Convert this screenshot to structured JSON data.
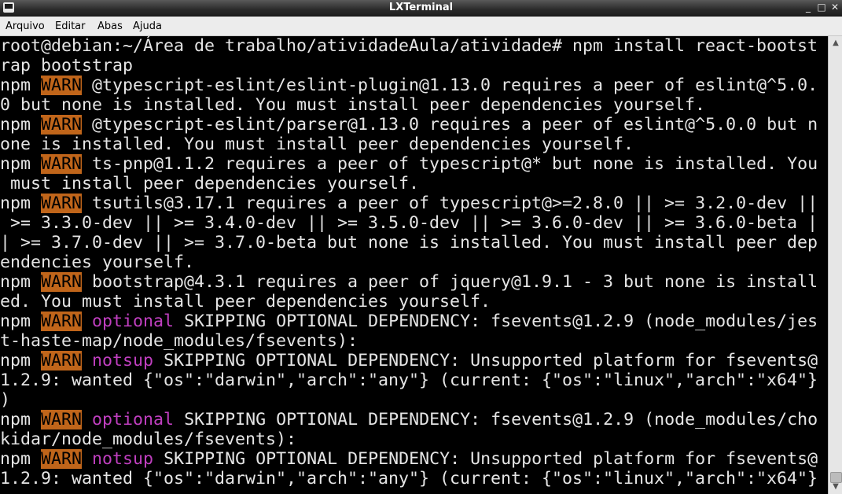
{
  "window": {
    "title": "LXTerminal",
    "buttons": {
      "minimize": "_",
      "maximize": "□",
      "close": "✕"
    }
  },
  "menubar": {
    "items": [
      "Arquivo",
      "Editar",
      "Abas",
      "Ajuda"
    ]
  },
  "terminal": {
    "lines": [
      [
        {
          "t": "root@debian:~/Área de trabalho/atividadeAula/atividade# npm install react-bootst"
        }
      ],
      [
        {
          "t": "rap bootstrap"
        }
      ],
      [
        {
          "t": "npm "
        },
        {
          "t": "WARN",
          "s": "warn"
        },
        {
          "t": " @typescript-eslint/eslint-plugin@1.13.0 requires a peer of eslint@^5.0."
        }
      ],
      [
        {
          "t": "0 but none is installed. You must install peer dependencies yourself."
        }
      ],
      [
        {
          "t": "npm "
        },
        {
          "t": "WARN",
          "s": "warn"
        },
        {
          "t": " @typescript-eslint/parser@1.13.0 requires a peer of eslint@^5.0.0 but n"
        }
      ],
      [
        {
          "t": "one is installed. You must install peer dependencies yourself."
        }
      ],
      [
        {
          "t": "npm "
        },
        {
          "t": "WARN",
          "s": "warn"
        },
        {
          "t": " ts-pnp@1.1.2 requires a peer of typescript@* but none is installed. You"
        }
      ],
      [
        {
          "t": " must install peer dependencies yourself."
        }
      ],
      [
        {
          "t": "npm "
        },
        {
          "t": "WARN",
          "s": "warn"
        },
        {
          "t": " tsutils@3.17.1 requires a peer of typescript@>=2.8.0 || >= 3.2.0-dev ||"
        }
      ],
      [
        {
          "t": " >= 3.3.0-dev || >= 3.4.0-dev || >= 3.5.0-dev || >= 3.6.0-dev || >= 3.6.0-beta |"
        }
      ],
      [
        {
          "t": "| >= 3.7.0-dev || >= 3.7.0-beta but none is installed. You must install peer dep"
        }
      ],
      [
        {
          "t": "endencies yourself."
        }
      ],
      [
        {
          "t": "npm "
        },
        {
          "t": "WARN",
          "s": "warn"
        },
        {
          "t": " bootstrap@4.3.1 requires a peer of jquery@1.9.1 - 3 but none is install"
        }
      ],
      [
        {
          "t": "ed. You must install peer dependencies yourself."
        }
      ],
      [
        {
          "t": "npm "
        },
        {
          "t": "WARN",
          "s": "warn"
        },
        {
          "t": " "
        },
        {
          "t": "optional",
          "s": "mag"
        },
        {
          "t": " SKIPPING OPTIONAL DEPENDENCY: fsevents@1.2.9 (node_modules/jes"
        }
      ],
      [
        {
          "t": "t-haste-map/node_modules/fsevents):"
        }
      ],
      [
        {
          "t": "npm "
        },
        {
          "t": "WARN",
          "s": "warn"
        },
        {
          "t": " "
        },
        {
          "t": "notsup",
          "s": "mag"
        },
        {
          "t": " SKIPPING OPTIONAL DEPENDENCY: Unsupported platform for fsevents@"
        }
      ],
      [
        {
          "t": "1.2.9: wanted {\"os\":\"darwin\",\"arch\":\"any\"} (current: {\"os\":\"linux\",\"arch\":\"x64\"}"
        }
      ],
      [
        {
          "t": ")"
        }
      ],
      [
        {
          "t": "npm "
        },
        {
          "t": "WARN",
          "s": "warn"
        },
        {
          "t": " "
        },
        {
          "t": "optional",
          "s": "mag"
        },
        {
          "t": " SKIPPING OPTIONAL DEPENDENCY: fsevents@1.2.9 (node_modules/cho"
        }
      ],
      [
        {
          "t": "kidar/node_modules/fsevents):"
        }
      ],
      [
        {
          "t": "npm "
        },
        {
          "t": "WARN",
          "s": "warn"
        },
        {
          "t": " "
        },
        {
          "t": "notsup",
          "s": "mag"
        },
        {
          "t": " SKIPPING OPTIONAL DEPENDENCY: Unsupported platform for fsevents@"
        }
      ],
      [
        {
          "t": "1.2.9: wanted {\"os\":\"darwin\",\"arch\":\"any\"} (current: {\"os\":\"linux\",\"arch\":\"x64\"}"
        }
      ]
    ]
  },
  "colors": {
    "background": "#000000",
    "text": "#e5e5e5",
    "warn_background": "#c0651a",
    "magenta": "#c03fc0"
  },
  "scrollbar": {
    "up": "▲",
    "down": "▼"
  }
}
